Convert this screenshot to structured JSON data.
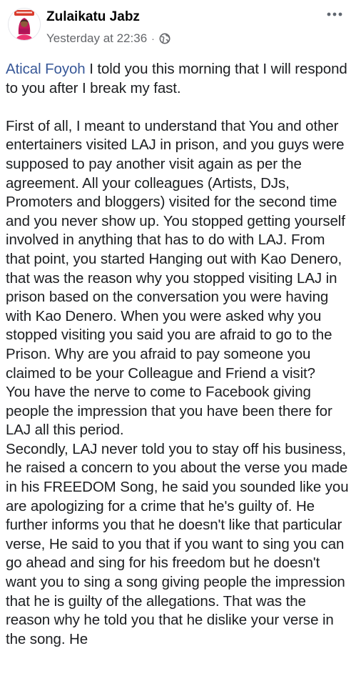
{
  "post": {
    "author": "Zulaikatu Jabz",
    "timestamp": "Yesterday at 22:36",
    "separator": "·",
    "privacy_icon": "globe-icon",
    "more_icon": "more-options-icon",
    "avatar_icon": "profile-avatar-icon",
    "mention": "Atical Foyoh",
    "first_line_rest": " I told you this morning that I will respond to you after I break my fast.",
    "paragraphs": [
      "First of all, I meant to understand that You and other entertainers visited LAJ in prison, and you guys were supposed to pay another visit again as per the agreement. All your colleagues (Artists, DJs, Promoters and bloggers) visited for the second time and you never show up. You stopped getting yourself involved in anything that has to do with LAJ. From that point, you started Hanging out with Kao Denero, that was the reason why you stopped visiting LAJ in prison based on the conversation you were having with Kao Denero. When you were asked why you stopped visiting you said you are afraid to go to the Prison. Why are you afraid to pay someone you claimed to be your Colleague and  Friend a visit?",
      "You have the nerve to come to Facebook giving people the impression that you have been there for LAJ all this period.",
      "Secondly, LAJ never told you to stay off his business, he raised a concern to you about the verse you made in his FREEDOM Song, he said you sounded like you are apologizing for a crime that he's guilty of. He further informs you that he doesn't like that particular verse, He said to you that if you want to sing you can go ahead and sing for his freedom but he doesn't want you to sing a song giving people the impression that he is guilty of the allegations. That was the reason why he told you that he dislike your verse in the song. He"
    ]
  },
  "colors": {
    "mention": "#385898",
    "meta_text": "#65676b",
    "body_text": "#1c1e21",
    "avatar_banner": "#d93a2b"
  }
}
